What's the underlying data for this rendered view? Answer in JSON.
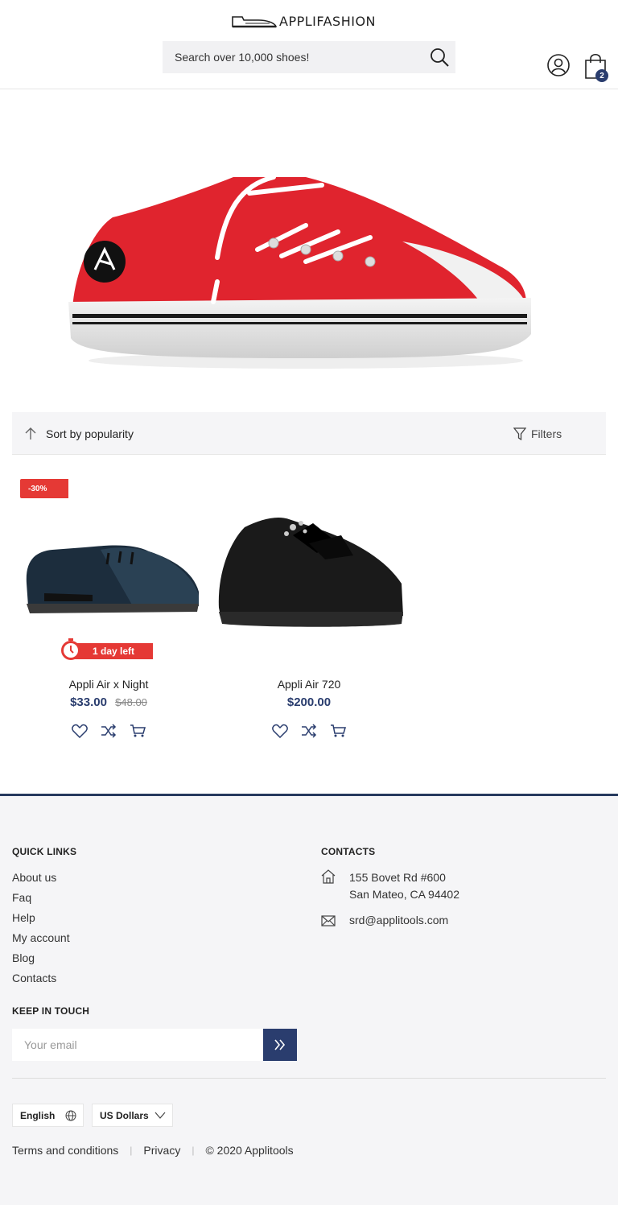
{
  "header": {
    "logo_text": "APPLIFASHION",
    "search_placeholder": "Search over 10,000 shoes!",
    "cart_count": "2",
    "icons": {
      "logo": "shoe-logo-icon",
      "search": "search-icon",
      "user": "user-icon",
      "cart": "cart-icon"
    }
  },
  "hero": {
    "icon": "red-sneaker-banner-image"
  },
  "toolbar": {
    "sort_label": "Sort by popularity",
    "filters_label": "Filters"
  },
  "products": [
    {
      "name": "Appli Air x Night",
      "price": "$33.00",
      "old_price": "$48.00",
      "discount": "-30%",
      "countdown": "1 day left"
    },
    {
      "name": "Appli Air 720",
      "price": "$200.00"
    }
  ],
  "footer": {
    "quick_links_title": "QUICK LINKS",
    "quick_links": [
      "About us",
      "Faq",
      "Help",
      "My account",
      "Blog",
      "Contacts"
    ],
    "contacts_title": "CONTACTS",
    "address_line1": "155 Bovet Rd #600",
    "address_line2": "San Mateo, CA 94402",
    "email": "srd@applitools.com",
    "keep_in_touch_title": "KEEP IN TOUCH",
    "email_placeholder": "Your email",
    "language": "English",
    "currency": "US Dollars",
    "terms": "Terms and conditions",
    "privacy": "Privacy",
    "copyright": "© 2020 Applitools"
  },
  "colors": {
    "accent": "#2a3d6e",
    "sale": "#e53935",
    "footer_bg": "#f5f5f7"
  }
}
